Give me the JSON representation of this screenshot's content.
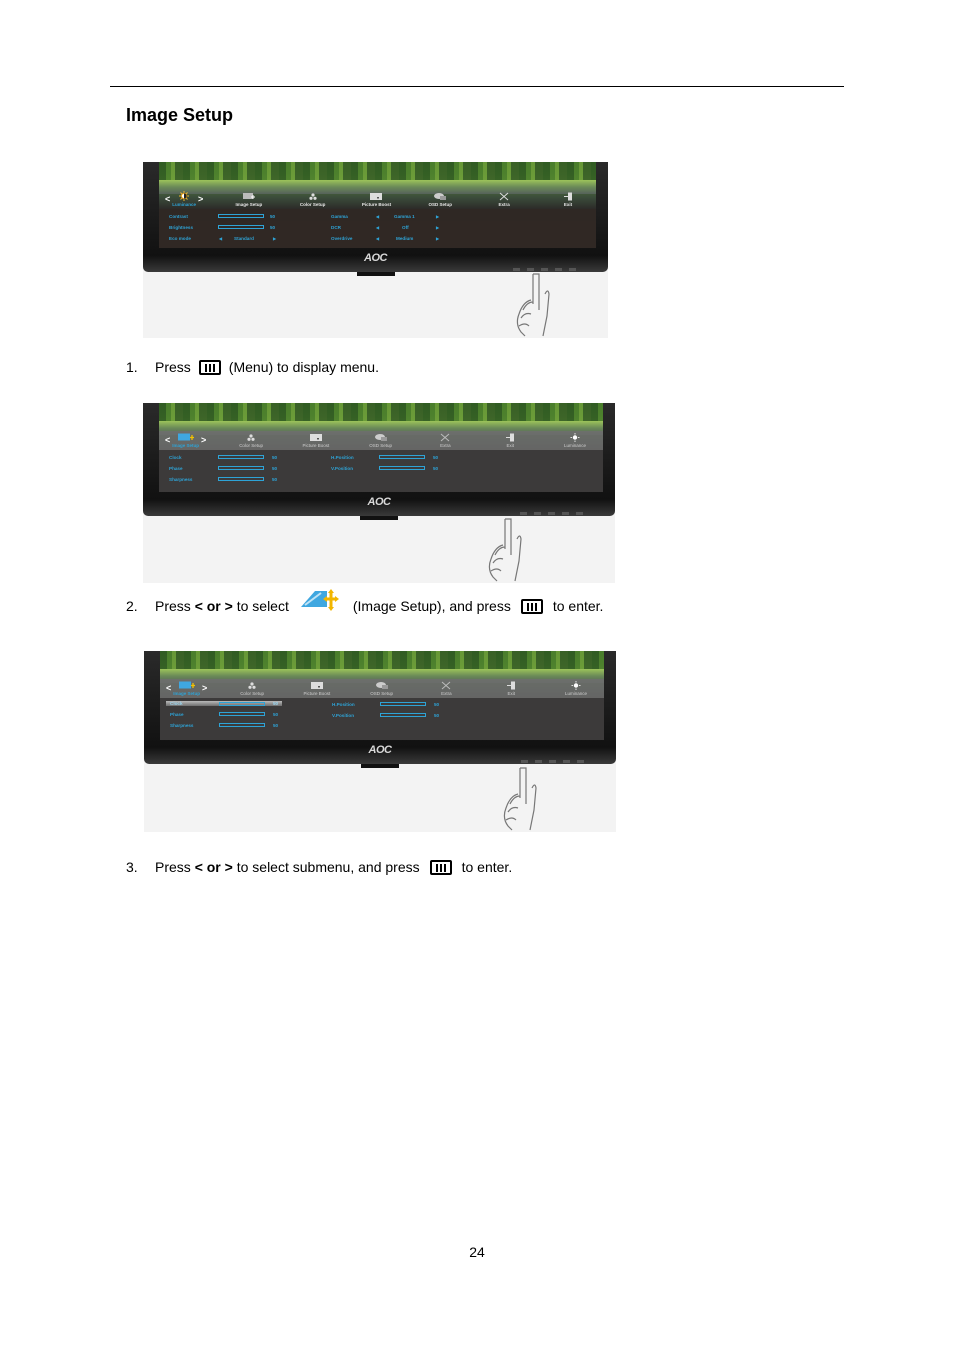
{
  "section": {
    "title": "Image Setup"
  },
  "figures": [
    {
      "osd_tabs": [
        "Luminance",
        "Image Setup",
        "Color Setup",
        "Picture Boost",
        "OSD Setup",
        "Extra",
        "Exit"
      ],
      "active_tab": "Luminance",
      "rows": [
        {
          "label": "Contrast",
          "type": "slider",
          "value": 50
        },
        {
          "label": "Brightness",
          "type": "slider",
          "value": 50
        },
        {
          "label": "Eco mode",
          "type": "select",
          "value": "Standard"
        },
        {
          "label": "Gamma",
          "type": "select",
          "value": "Gamma 1"
        },
        {
          "label": "DCR",
          "type": "select",
          "value": "Off"
        },
        {
          "label": "Overdrive",
          "type": "select",
          "value": "Medium"
        }
      ],
      "logo": "AOC"
    },
    {
      "osd_tabs": [
        "Image Setup",
        "Color Setup",
        "Picture Boost",
        "OSD Setup",
        "Extra",
        "Exit",
        "Luminance"
      ],
      "active_tab": "Image Setup",
      "rows": [
        {
          "label": "Clock",
          "type": "slider",
          "value": 50
        },
        {
          "label": "Phase",
          "type": "slider",
          "value": 50
        },
        {
          "label": "Sharpness",
          "type": "slider",
          "value": 50
        },
        {
          "label": "H.Position",
          "type": "slider",
          "value": 50
        },
        {
          "label": "V.Position",
          "type": "slider",
          "value": 50
        }
      ],
      "logo": "AOC"
    },
    {
      "osd_tabs": [
        "Image Setup",
        "Color Setup",
        "Picture Boost",
        "OSD Setup",
        "Extra",
        "Exit",
        "Luminance"
      ],
      "active_tab": "Image Setup",
      "selected_row": "Clock",
      "rows": [
        {
          "label": "Clock",
          "type": "slider",
          "value": 50
        },
        {
          "label": "Phase",
          "type": "slider",
          "value": 50
        },
        {
          "label": "Sharpness",
          "type": "slider",
          "value": 50
        },
        {
          "label": "H.Position",
          "type": "slider",
          "value": 50
        },
        {
          "label": "V.Position",
          "type": "slider",
          "value": 50
        }
      ],
      "logo": "AOC"
    }
  ],
  "steps": [
    {
      "number": "1.",
      "parts": [
        "Press",
        "(Menu) to display menu."
      ],
      "icons": [
        "menu-key-icon"
      ]
    },
    {
      "number": "2.",
      "parts": [
        "Press",
        "< or >",
        "to select",
        "(Image Setup), and press",
        "to enter."
      ],
      "icons": [
        "image-setup-icon",
        "menu-key-icon"
      ]
    },
    {
      "number": "3.",
      "parts": [
        "Press",
        "< or >",
        "to select submenu, and press",
        "to enter."
      ],
      "icons": [
        "menu-key-icon"
      ]
    }
  ],
  "colors": {
    "osd_accent": "#2ea3d6"
  },
  "page_number": "24"
}
